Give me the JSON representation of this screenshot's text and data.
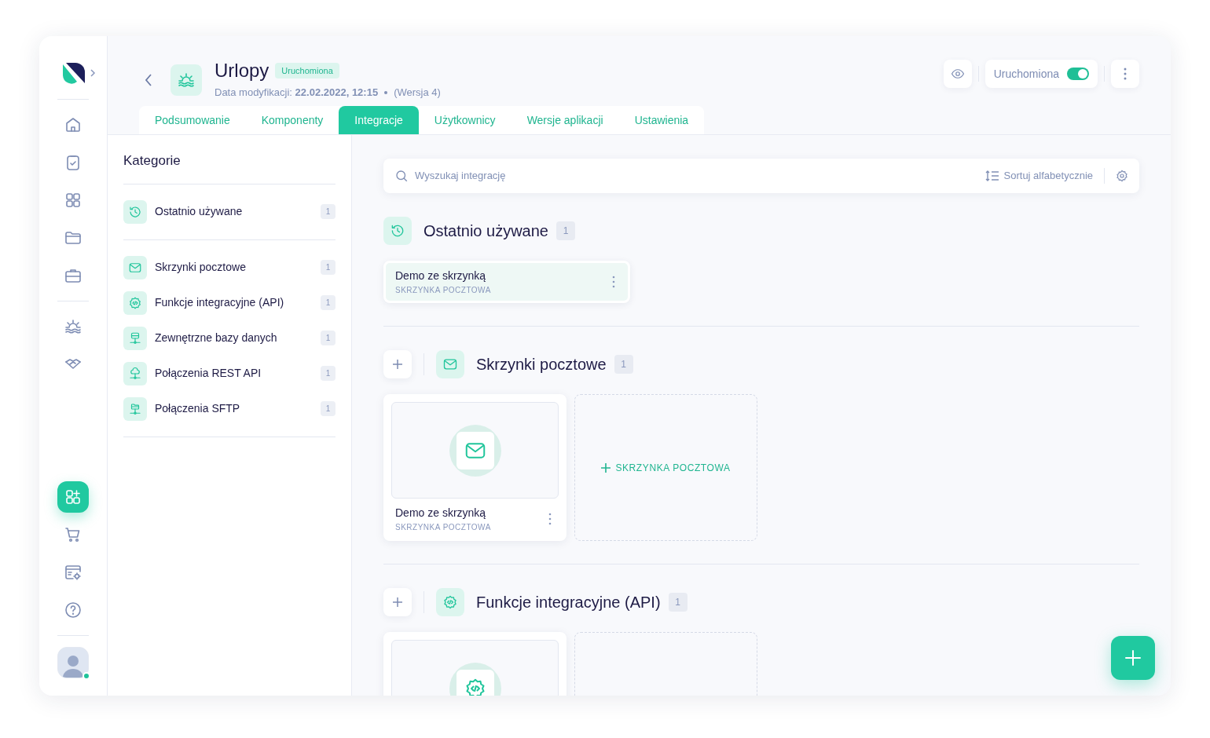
{
  "nav": {
    "groups": [
      [
        {
          "selected": false
        },
        {
          "selected": false
        },
        {
          "selected": false
        },
        {
          "selected": false
        },
        {
          "selected": false
        }
      ],
      [
        {
          "selected": false
        },
        {
          "selected": false
        }
      ],
      [
        {
          "selected": true
        },
        {
          "selected": false
        },
        {
          "selected": false
        },
        {
          "selected": false
        }
      ]
    ],
    "avatar": {
      "online": true
    }
  },
  "header": {
    "title": "Urlopy",
    "status_badge": "Uruchomiona",
    "modified": "Data modyfikacji: **22.02.2022, 12:15**",
    "version": "(Wersja 4)"
  },
  "toolbar": {
    "toggle_label": "Uruchomiona",
    "toggle_on": true
  },
  "tabs": [
    {
      "label": "Podsumowanie",
      "selected": false
    },
    {
      "label": "Komponenty",
      "selected": false
    },
    {
      "label": "Integracje",
      "selected": true
    },
    {
      "label": "Użytkownicy",
      "selected": false
    },
    {
      "label": "Wersje aplikacji",
      "selected": false
    },
    {
      "label": "Ustawienia",
      "selected": false
    }
  ],
  "categories": {
    "title": "Kategorie",
    "groups": [
      [
        {
          "label": "Ostatnio używane",
          "count": "1"
        }
      ],
      [
        {
          "label": "Skrzynki pocztowe",
          "count": "1"
        },
        {
          "label": "Funkcje integracyjne (API)",
          "count": "1"
        },
        {
          "label": "Zewnętrzne bazy danych",
          "count": "1"
        },
        {
          "label": "Połączenia REST API",
          "count": "1"
        },
        {
          "label": "Połączenia SFTP",
          "count": "1"
        }
      ]
    ]
  },
  "search": {
    "placeholder": "Wyszukaj integrację",
    "sort_label": "Sortuj alfabetycznie"
  },
  "sections": [
    {
      "title": "Ostatnio używane",
      "count": "1",
      "addable": false,
      "cards": [
        {
          "kind": "compact",
          "name": "Demo ze skrzynką",
          "type": "SKRZYNKA POCZTOWA"
        }
      ]
    },
    {
      "title": "Skrzynki pocztowe",
      "count": "1",
      "addable": true,
      "cards": [
        {
          "kind": "tile",
          "name": "Demo ze skrzynką",
          "type": "SKRZYNKA POCZTOWA"
        }
      ],
      "add_tile": true,
      "add_tile_label": "SKRZYNKA POCZTOWA"
    },
    {
      "title": "Funkcje integracyjne (API)",
      "count": "1",
      "addable": true,
      "cards": [
        {
          "kind": "preview"
        }
      ],
      "add_tile": true
    }
  ]
}
